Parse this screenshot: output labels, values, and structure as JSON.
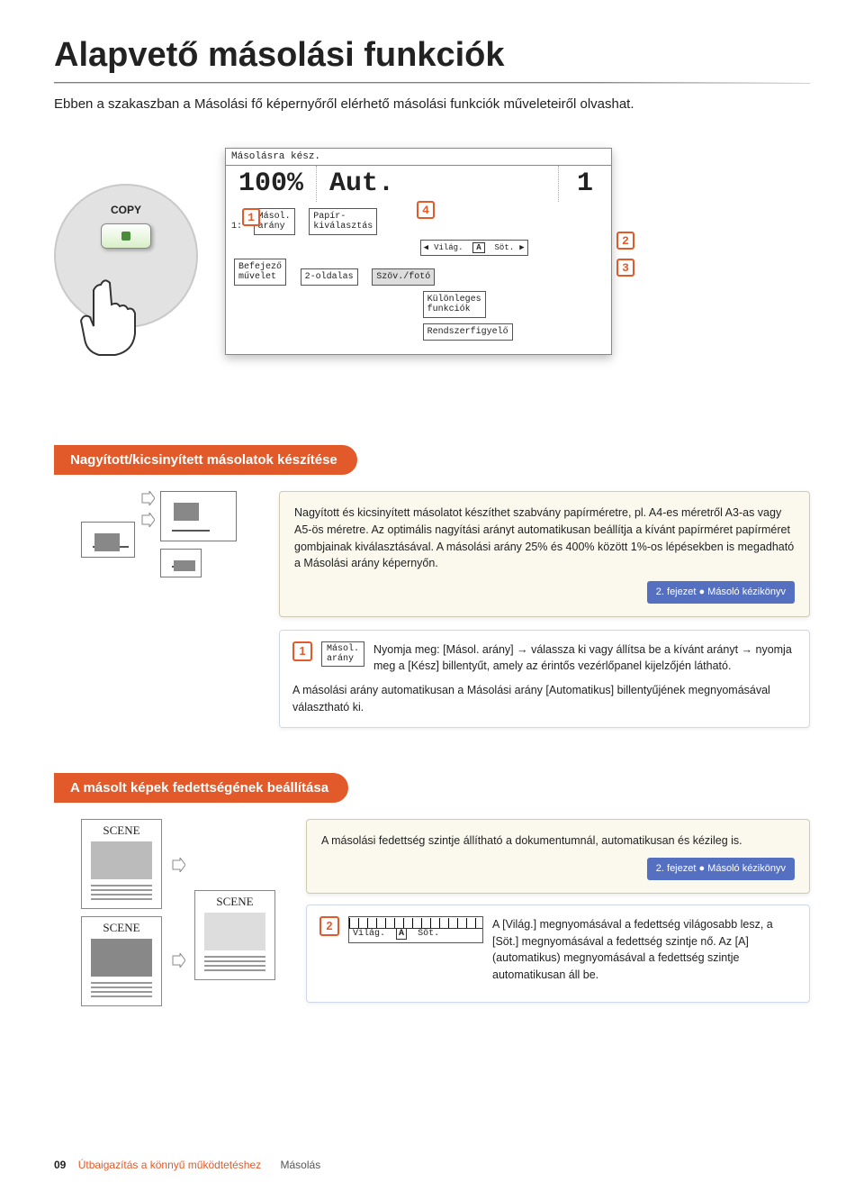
{
  "title": "Alapvető másolási funkciók",
  "intro": "Ebben a szakaszban a Másolási fő képernyőről elérhető másolási funkciók műveleteiről olvashat.",
  "device": {
    "copy_label": "COPY"
  },
  "screen": {
    "ready": "Másolásra kész.",
    "zoom": "100%",
    "mode": "Aut.",
    "copies": "1",
    "ratio_idx": "1:",
    "btn_ratio": "Másol.\narány",
    "btn_paper": "Papír-\nkiválasztás",
    "density_light": "Világ.",
    "density_auto": "A",
    "density_dark": "Söt.",
    "btn_finish": "Befejező\nművelet",
    "btn_2side": "2-oldalas",
    "btn_textphoto": "Szöv./fotó",
    "btn_special": "Különleges\nfunkciók",
    "btn_monitor": "Rendszerfigyelő"
  },
  "badges": {
    "b1": "1",
    "b2": "2",
    "b3": "3",
    "b4": "4"
  },
  "section1": {
    "tab": "Nagyított/kicsinyített másolatok készítése",
    "desc": "Nagyított és kicsinyített másolatot készíthet szabvány papírméretre, pl. A4-es méretről A3-as vagy A5-ös méretre. Az optimális nagyítási arányt automatikusan beállítja a kívánt papírméret papírméret gombjainak kiválasztásával. A másolási arány 25% és 400% között 1%-os lépésekben is megadható a Másolási arány képernyőn.",
    "chapter": "2. fejezet ● Másoló kézikönyv",
    "step_num": "1",
    "step_btn": "Másol.\narány",
    "step_text": "Nyomja meg: [Másol. arány] → válassza ki vagy állítsa be a kívánt arányt → nyomja meg a [Kész] billentyűt, amely az érintős vezérlőpanel kijelzőjén látható.",
    "step_note": "A másolási arány automatikusan a Másolási arány [Automatikus] billentyűjének megnyomásával választható ki."
  },
  "section2": {
    "tab": "A másolt képek fedettségének beállítása",
    "scene_label": "SCENE",
    "desc": "A másolási fedettség szintje állítható a dokumentumnál, automatikusan és kézileg is.",
    "chapter": "2. fejezet ● Másoló kézikönyv",
    "step_num": "2",
    "density_light": "Világ.",
    "density_auto": "A",
    "density_dark": "Söt.",
    "step_text": "A [Világ.] megnyomásával a fedettség világosabb lesz, a [Söt.] megnyomásával a fedettség szintje nő. Az [A] (automatikus) megnyomásával a fedettség szintje automatikusan áll be."
  },
  "footer": {
    "page": "09",
    "guide": "Útbaigazítás a könnyű működtetéshez",
    "section": "Másolás"
  }
}
